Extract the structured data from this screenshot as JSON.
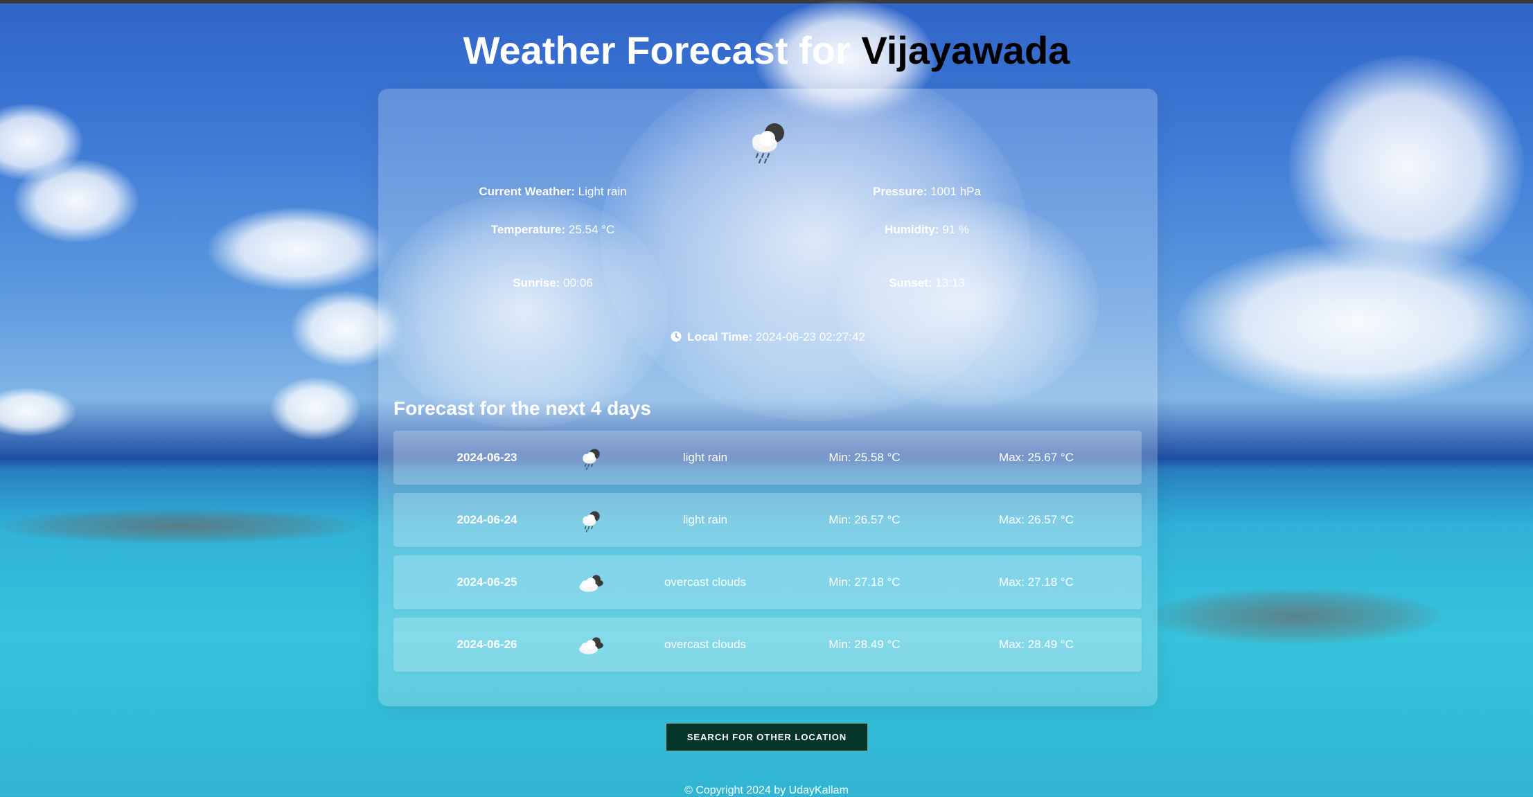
{
  "header": {
    "title_prefix": "Weather Forecast for ",
    "city": "Vijayawada"
  },
  "current": {
    "icon": "rain-cloud-moon-icon",
    "weather_label": "Current Weather:",
    "weather_value": "Light rain",
    "pressure_label": "Pressure:",
    "pressure_value": "1001 hPa",
    "temperature_label": "Temperature:",
    "temperature_value": "25.54 °C",
    "humidity_label": "Humidity:",
    "humidity_value": "91 %",
    "sunrise_label": "Sunrise:",
    "sunrise_value": "00:06",
    "sunset_label": "Sunset:",
    "sunset_value": "13:13",
    "local_time_label": "Local Time:",
    "local_time_value": "2024-06-23 02:27:42"
  },
  "forecast": {
    "heading": "Forecast for the next 4 days",
    "days": [
      {
        "date": "2024-06-23",
        "icon": "rain-cloud-moon-icon",
        "description": "light rain",
        "min": "Min: 25.58 °C",
        "max": "Max: 25.67 °C"
      },
      {
        "date": "2024-06-24",
        "icon": "rain-cloud-moon-icon",
        "description": "light rain",
        "min": "Min: 26.57 °C",
        "max": "Max: 26.57 °C"
      },
      {
        "date": "2024-06-25",
        "icon": "overcast-cloud-icon",
        "description": "overcast clouds",
        "min": "Min: 27.18 °C",
        "max": "Max: 27.18 °C"
      },
      {
        "date": "2024-06-26",
        "icon": "overcast-cloud-icon",
        "description": "overcast clouds",
        "min": "Min: 28.49 °C",
        "max": "Max: 28.49 °C"
      }
    ]
  },
  "search_button_label": "SEARCH FOR OTHER LOCATION",
  "footer": "© Copyright 2024 by UdayKallam",
  "colors": {
    "button_bg": "#06352a",
    "title_city": "#000000",
    "text": "#ffffff"
  }
}
